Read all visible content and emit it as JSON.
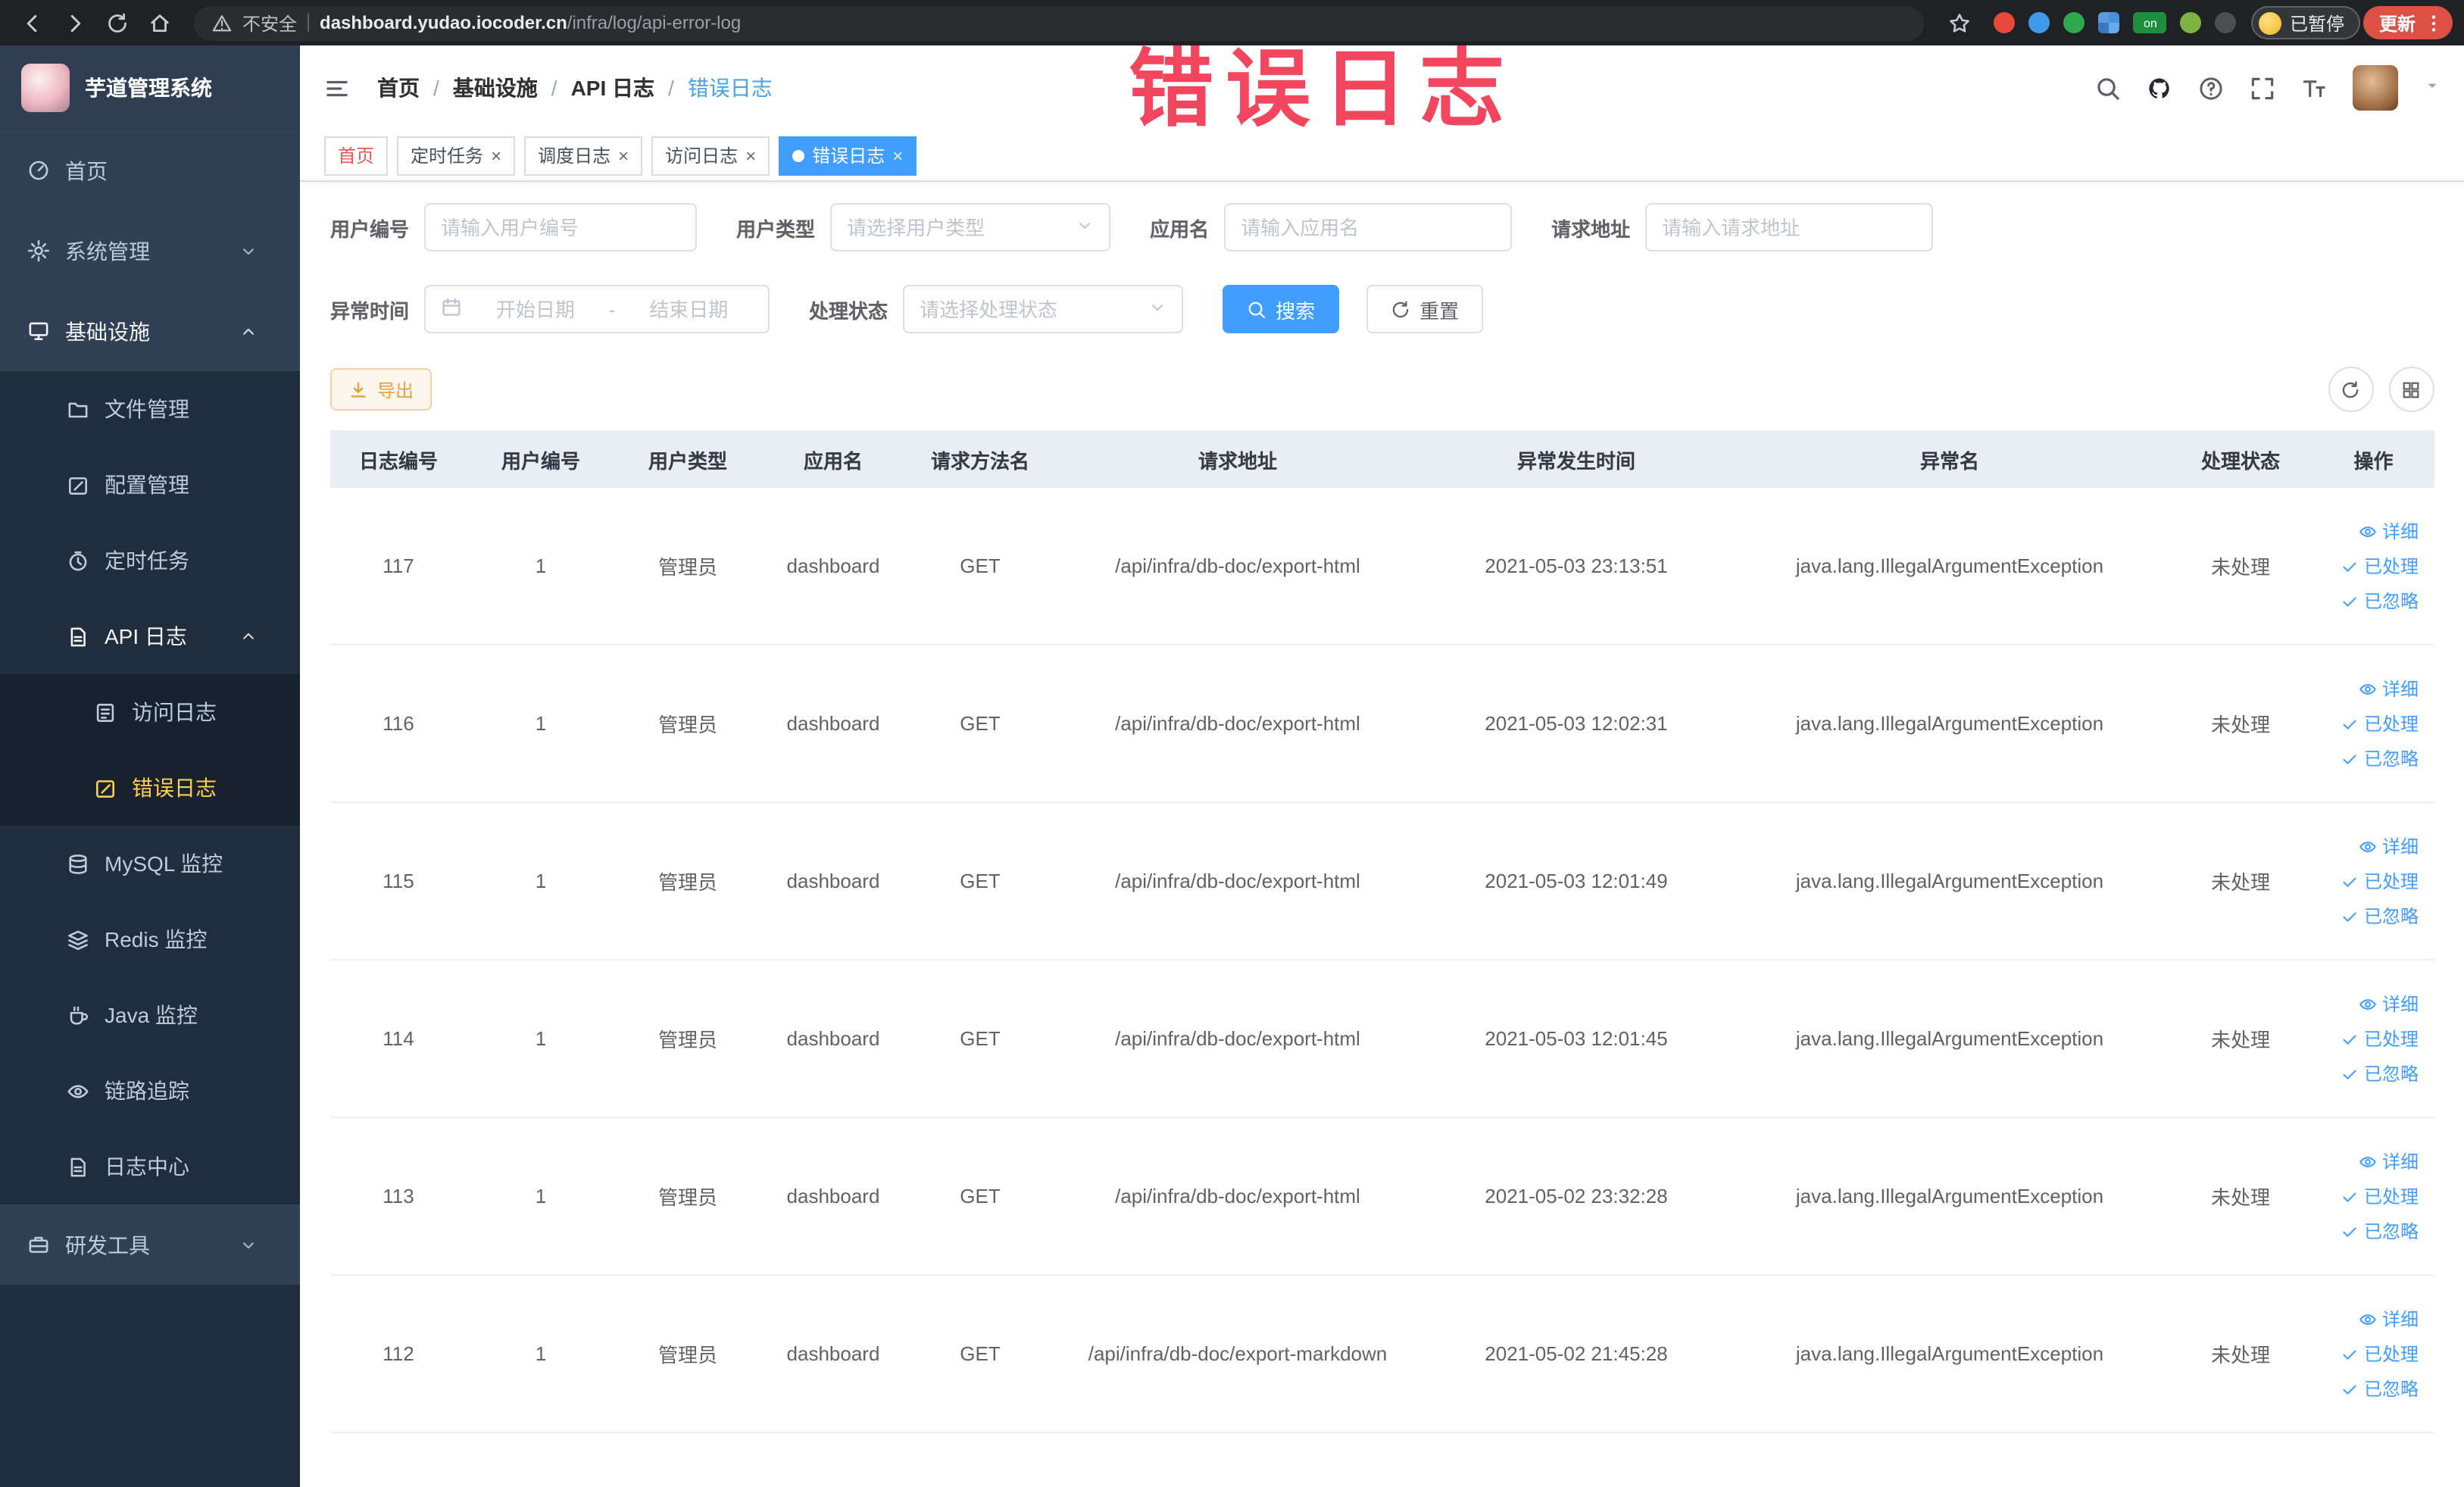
{
  "watermark": "错误日志",
  "colors": {
    "primary": "#409eff",
    "menu_active": "#ffd04b",
    "export_accent": "#e6a23c",
    "watermark": "#f2455e",
    "update_button": "#dd5145",
    "tab_home_text": "#e25a5a"
  },
  "browser": {
    "security_label": "不安全",
    "url_host": "dashboard.yudao.iocoder.cn",
    "url_path": "/infra/log/api-error-log",
    "extension_badge_on": "on",
    "paused_label": "已暂停",
    "update_label": "更新"
  },
  "sidebar": {
    "title": "芋道管理系统",
    "items": [
      {
        "label": "首页",
        "icon": "home",
        "level": 0
      },
      {
        "label": "系统管理",
        "icon": "gear",
        "level": 0,
        "arrow": "down"
      },
      {
        "label": "基础设施",
        "icon": "infra",
        "level": 0,
        "arrow": "up",
        "open": true
      },
      {
        "label": "文件管理",
        "icon": "folder",
        "level": 1
      },
      {
        "label": "配置管理",
        "icon": "edit",
        "level": 1
      },
      {
        "label": "定时任务",
        "icon": "timer",
        "level": 1
      },
      {
        "label": "API 日志",
        "icon": "log",
        "level": 1,
        "arrow": "up",
        "open": true
      },
      {
        "label": "访问日志",
        "icon": "doc",
        "level": 2
      },
      {
        "label": "错误日志",
        "icon": "edit",
        "level": 2,
        "active": true
      },
      {
        "label": "MySQL 监控",
        "icon": "db",
        "level": 1
      },
      {
        "label": "Redis 监控",
        "icon": "layers",
        "level": 1
      },
      {
        "label": "Java 监控",
        "icon": "java",
        "level": 1
      },
      {
        "label": "链路追踪",
        "icon": "eye",
        "level": 1
      },
      {
        "label": "日志中心",
        "icon": "log",
        "level": 1
      },
      {
        "label": "研发工具",
        "icon": "toolbox",
        "level": 0,
        "arrow": "down"
      }
    ]
  },
  "breadcrumb": [
    "首页",
    "基础设施",
    "API 日志",
    "错误日志"
  ],
  "breadcrumb_separator": "/",
  "tabs": [
    {
      "label": "首页",
      "closable": false,
      "active": false,
      "text_color": "#e25a5a"
    },
    {
      "label": "定时任务",
      "closable": true,
      "active": false
    },
    {
      "label": "调度日志",
      "closable": true,
      "active": false
    },
    {
      "label": "访问日志",
      "closable": true,
      "active": false
    },
    {
      "label": "错误日志",
      "closable": true,
      "active": true
    }
  ],
  "filters": {
    "fields": [
      {
        "label": "用户编号",
        "type": "input",
        "placeholder": "请输入用户编号"
      },
      {
        "label": "用户类型",
        "type": "select",
        "placeholder": "请选择用户类型"
      },
      {
        "label": "应用名",
        "type": "input",
        "placeholder": "请输入应用名"
      },
      {
        "label": "请求地址",
        "type": "input",
        "placeholder": "请输入请求地址"
      },
      {
        "label": "异常时间",
        "type": "daterange",
        "start_placeholder": "开始日期",
        "end_placeholder": "结束日期",
        "separator": "-"
      },
      {
        "label": "处理状态",
        "type": "select",
        "placeholder": "请选择处理状态"
      }
    ],
    "search_label": "搜索",
    "reset_label": "重置"
  },
  "toolbar": {
    "export_label": "导出"
  },
  "table": {
    "columns": [
      "日志编号",
      "用户编号",
      "用户类型",
      "应用名",
      "请求方法名",
      "请求地址",
      "异常发生时间",
      "异常名",
      "处理状态",
      "操作"
    ],
    "rows": [
      [
        "117",
        "1",
        "管理员",
        "dashboard",
        "GET",
        "/api/infra/db-doc/export-html",
        "2021-05-03 23:13:51",
        "java.lang.IllegalArgumentException",
        "未处理"
      ],
      [
        "116",
        "1",
        "管理员",
        "dashboard",
        "GET",
        "/api/infra/db-doc/export-html",
        "2021-05-03 12:02:31",
        "java.lang.IllegalArgumentException",
        "未处理"
      ],
      [
        "115",
        "1",
        "管理员",
        "dashboard",
        "GET",
        "/api/infra/db-doc/export-html",
        "2021-05-03 12:01:49",
        "java.lang.IllegalArgumentException",
        "未处理"
      ],
      [
        "114",
        "1",
        "管理员",
        "dashboard",
        "GET",
        "/api/infra/db-doc/export-html",
        "2021-05-03 12:01:45",
        "java.lang.IllegalArgumentException",
        "未处理"
      ],
      [
        "113",
        "1",
        "管理员",
        "dashboard",
        "GET",
        "/api/infra/db-doc/export-html",
        "2021-05-02 23:32:28",
        "java.lang.IllegalArgumentException",
        "未处理"
      ],
      [
        "112",
        "1",
        "管理员",
        "dashboard",
        "GET",
        "/api/infra/db-doc/export-markdown",
        "2021-05-02 21:45:28",
        "java.lang.IllegalArgumentException",
        "未处理"
      ]
    ],
    "row_actions": [
      {
        "label": "详细",
        "icon": "eye"
      },
      {
        "label": "已处理",
        "icon": "check"
      },
      {
        "label": "已忽略",
        "icon": "check"
      }
    ]
  }
}
